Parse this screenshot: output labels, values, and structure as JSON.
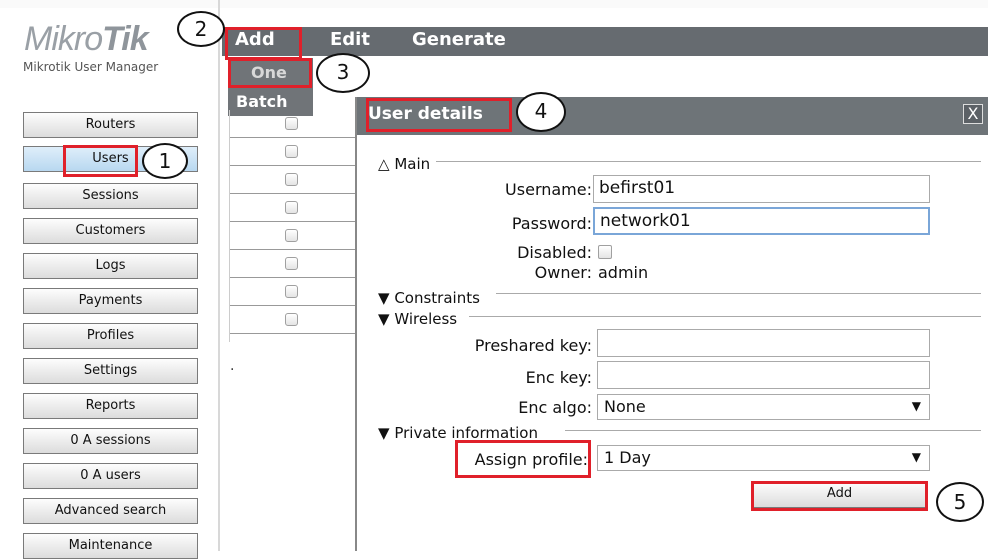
{
  "app": {
    "logo_a": "Mikro",
    "logo_b": "Tik",
    "subtitle": "Mikrotik User Manager"
  },
  "sidebar": {
    "items": [
      {
        "label": "Routers"
      },
      {
        "label": "Users"
      },
      {
        "label": "Sessions"
      },
      {
        "label": "Customers"
      },
      {
        "label": "Logs"
      },
      {
        "label": "Payments"
      },
      {
        "label": "Profiles"
      },
      {
        "label": "Settings"
      },
      {
        "label": "Reports"
      },
      {
        "label": "0 A sessions"
      },
      {
        "label": "0 A users"
      },
      {
        "label": "Advanced search"
      },
      {
        "label": "Maintenance"
      }
    ]
  },
  "menubar": {
    "add": "Add",
    "edit": "Edit",
    "generate": "Generate"
  },
  "add_dropdown": {
    "one": "One",
    "batch": "Batch"
  },
  "table": {
    "dot": "."
  },
  "dialog": {
    "title": "User details",
    "close": "X",
    "sections": {
      "main": "Main",
      "constraints": "Constraints",
      "wireless": "Wireless",
      "private": "Private information"
    },
    "fields": {
      "username_label": "Username:",
      "username_value": "befirst01",
      "password_label": "Password:",
      "password_value": "network01",
      "disabled_label": "Disabled:",
      "owner_label": "Owner:",
      "owner_value": "admin",
      "preshared_label": "Preshared key:",
      "preshared_value": "",
      "enckey_label": "Enc key:",
      "enckey_value": "",
      "encalgo_label": "Enc algo:",
      "encalgo_value": "None",
      "assign_label": "Assign profile:",
      "assign_value": "1 Day"
    },
    "add_button": "Add"
  },
  "annotations": {
    "step1": "1",
    "step2": "2",
    "step3": "3",
    "step4": "4",
    "step5": "5",
    "highlight_color": "#e0202a"
  },
  "icons": {
    "collapse": "triangle-up-outline-icon",
    "expand": "triangle-down-icon",
    "dropdown": "chevron-down-icon"
  }
}
